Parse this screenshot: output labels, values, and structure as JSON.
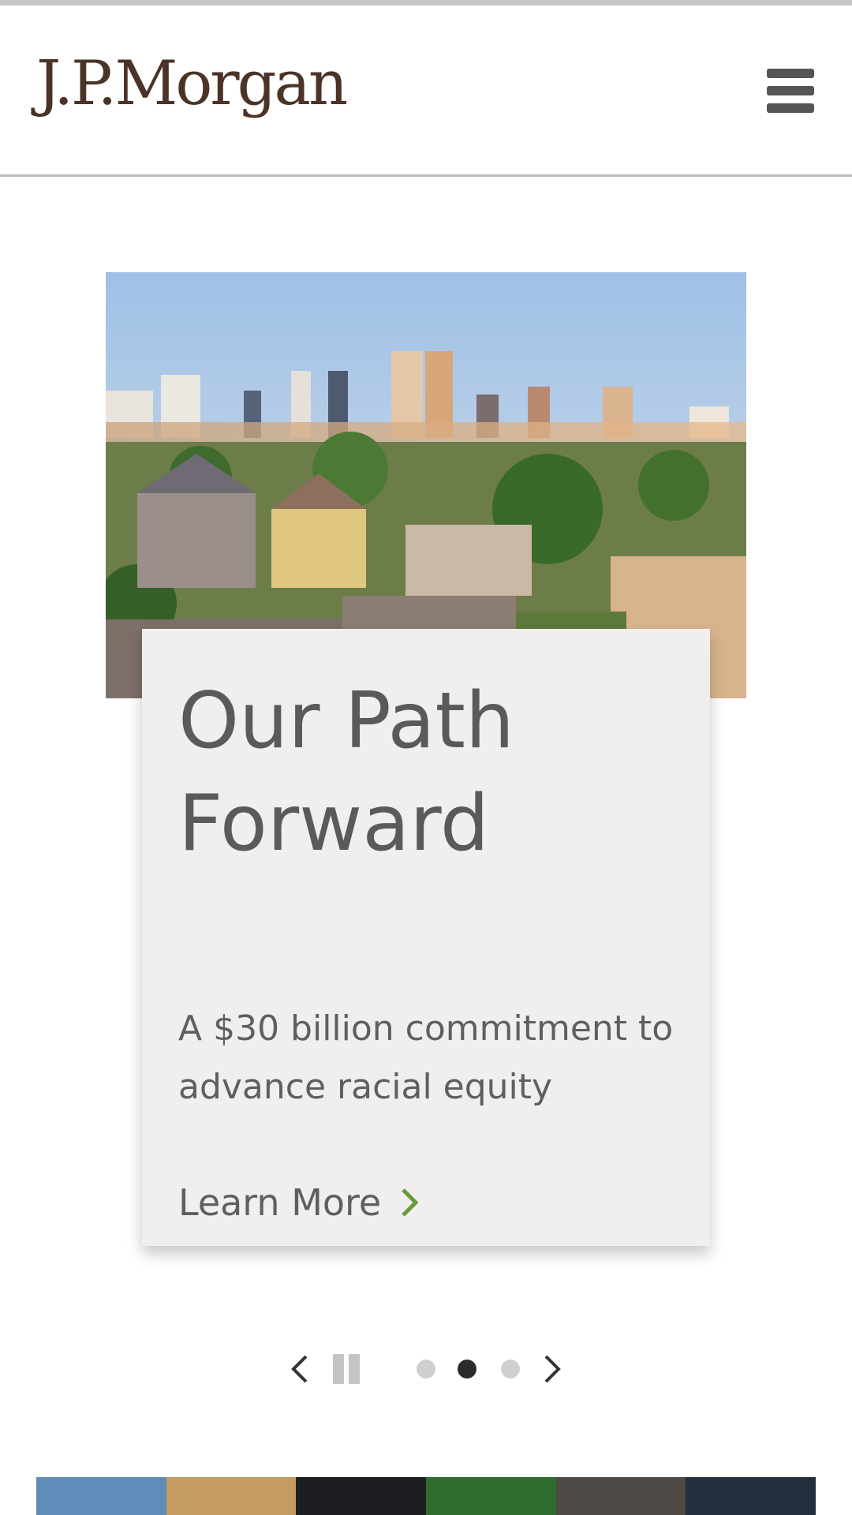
{
  "header": {
    "logo_text": "J.P.Morgan",
    "menu_icon": "hamburger-menu-icon"
  },
  "hero": {
    "image_subject": "city-skyline-photo",
    "title": "Our Path Forward",
    "description": "A $30 billion commitment to advance racial equity",
    "cta_label": "Learn More",
    "cta_icon": "chevron-right-icon",
    "cta_icon_color": "#6a9a3a"
  },
  "carousel": {
    "prev_icon": "chevron-left-icon",
    "pause_icon": "pause-icon",
    "next_icon": "chevron-right-icon",
    "slide_count": 3,
    "active_slide": 2
  },
  "colors": {
    "logo": "#4b3328",
    "card_background": "#f0efee",
    "active_dot": "#2b2b2b",
    "inactive_dot": "#cfcfcf"
  }
}
